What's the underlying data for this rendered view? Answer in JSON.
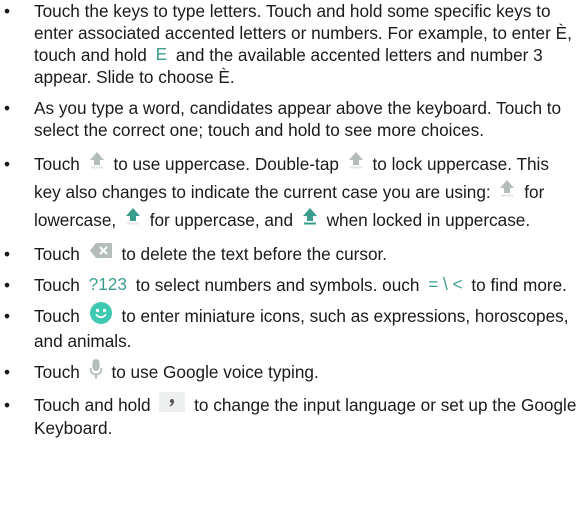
{
  "items": [
    {
      "a": "Touch the keys to type letters. Touch and hold some specific keys to enter associated accented letters or numbers. For example, to enter È, touch and hold",
      "key": "E",
      "b": "and the available accented letters and number 3 appear. Slide to choose È."
    },
    {
      "a": "As you type a word, candidates appear above the keyboard. Touch to select the correct one; touch and hold to see more choices."
    },
    {
      "a": "Touch",
      "b": "to use uppercase. Double-tap",
      "c": "to lock uppercase. This key also changes to indicate the current case you are using:",
      "d": "for lowercase,",
      "e": "for uppercase, and",
      "f": "when locked in uppercase."
    },
    {
      "a": "Touch",
      "b": "to delete the text before the cursor."
    },
    {
      "a": "Touch",
      "key1": "?123",
      "b": "to select numbers and symbols. ouch",
      "key2": "= \\ <",
      "c": "to find more."
    },
    {
      "a": "Touch",
      "b": "to enter miniature icons, such as expressions, horoscopes, and animals."
    },
    {
      "a": "Touch",
      "b": "to use Google voice typing."
    },
    {
      "a": "Touch and hold",
      "b": "to change the input language or set up the Google Keyboard."
    }
  ],
  "icons": {
    "shift_lower": "shift-arrow-icon",
    "shift_upper": "shift-arrow-icon",
    "caps_lock": "caps-lock-icon",
    "delete": "backspace-icon",
    "emoji": "emoji-icon",
    "voice": "microphone-icon",
    "language": "comma-settings-icon"
  },
  "colors": {
    "key_accent": "#3a9d8e",
    "icon_gray": "#b5bcbc",
    "icon_light": "#e3e6e6"
  }
}
